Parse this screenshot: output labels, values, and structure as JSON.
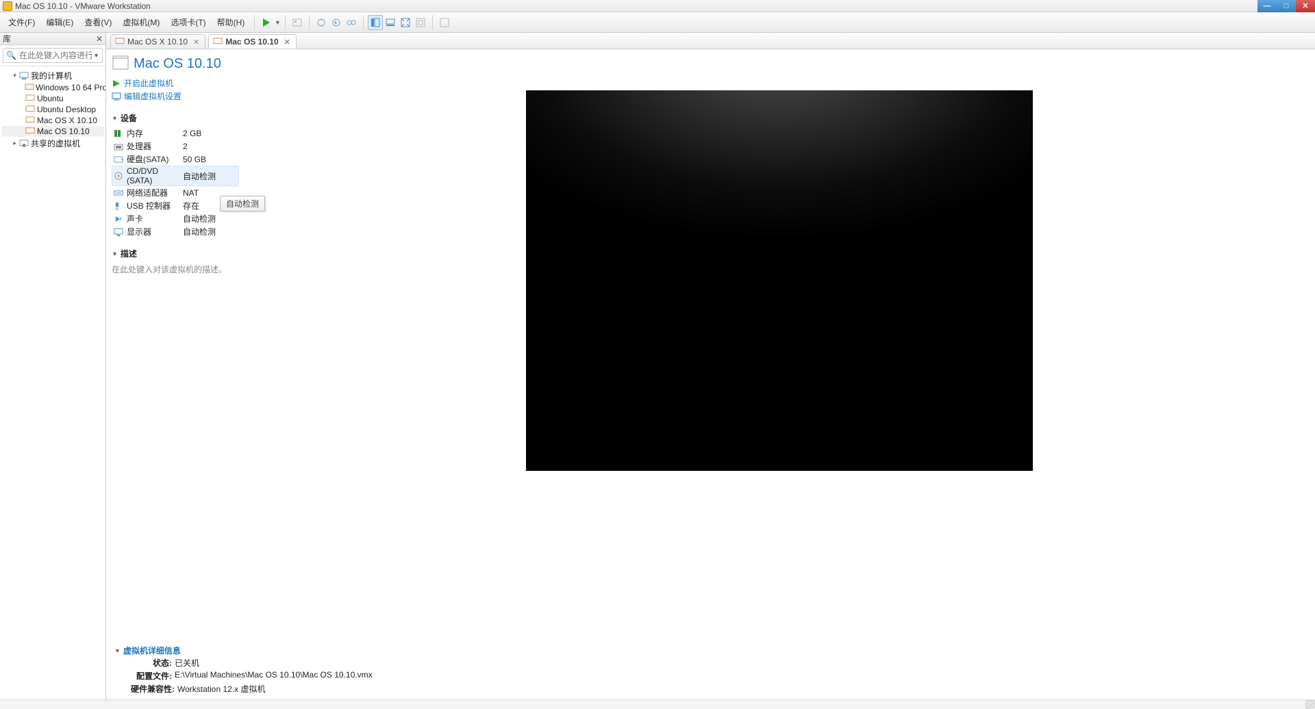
{
  "window": {
    "title": "Mac OS  10.10 - VMware Workstation"
  },
  "menubar": [
    "文件(F)",
    "编辑(E)",
    "查看(V)",
    "虚拟机(M)",
    "选项卡(T)",
    "帮助(H)"
  ],
  "library": {
    "header": "库",
    "search_placeholder": "在此处键入内容进行…",
    "root": "我的计算机",
    "items": [
      "Windows 10 64 Pro",
      "Ubuntu",
      "Ubuntu Desktop",
      "Mac OS X 10.10",
      "Mac OS  10.10"
    ],
    "shared": "共享的虚拟机"
  },
  "tabs": [
    {
      "label": "Mac OS X 10.10",
      "active": false
    },
    {
      "label": "Mac OS  10.10",
      "active": true
    }
  ],
  "vm": {
    "name": "Mac OS  10.10",
    "actions": {
      "power_on": "开启此虚拟机",
      "edit": "编辑虚拟机设置"
    },
    "sections": {
      "devices": "设备",
      "description": "描述",
      "details": "虚拟机详细信息"
    },
    "desc_placeholder": "在此处键入对该虚拟机的描述。",
    "devices": [
      {
        "name": "内存",
        "value": "2 GB"
      },
      {
        "name": "处理器",
        "value": "2"
      },
      {
        "name": "硬盘(SATA)",
        "value": "50 GB"
      },
      {
        "name": "CD/DVD (SATA)",
        "value": "自动检测",
        "selected": true
      },
      {
        "name": "网络适配器",
        "value": "NAT"
      },
      {
        "name": "USB 控制器",
        "value": "存在"
      },
      {
        "name": "声卡",
        "value": "自动检测"
      },
      {
        "name": "显示器",
        "value": "自动检测"
      }
    ],
    "tooltip": "自动检测",
    "details": {
      "state_k": "状态:",
      "state_v": "已关机",
      "config_k": "配置文件:",
      "config_v": "E:\\Virtual Machines\\Mac OS  10.10\\Mac OS  10.10.vmx",
      "compat_k": "硬件兼容性:",
      "compat_v": "Workstation 12.x 虚拟机"
    }
  }
}
